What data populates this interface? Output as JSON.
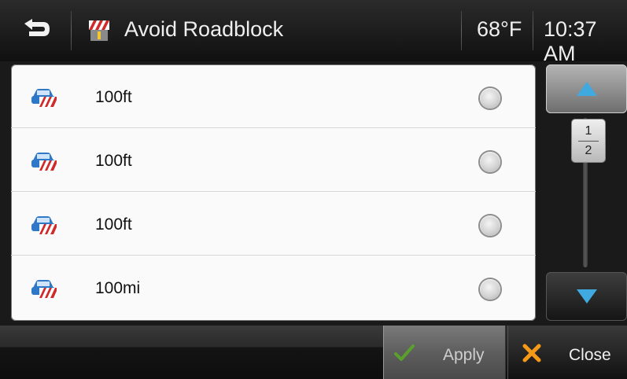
{
  "header": {
    "title": "Avoid Roadblock",
    "temperature": "68°F",
    "time": "10:37 AM",
    "back_icon": "back-arrow-icon",
    "title_icon": "roadblock-icon"
  },
  "list": {
    "items": [
      {
        "label": "100ft",
        "icon": "car-roadblock-icon",
        "selected": false
      },
      {
        "label": "100ft",
        "icon": "car-roadblock-icon",
        "selected": false
      },
      {
        "label": "100ft",
        "icon": "car-roadblock-icon",
        "selected": false
      },
      {
        "label": "100mi",
        "icon": "car-roadblock-icon",
        "selected": false
      }
    ]
  },
  "scroll": {
    "current_page": "1",
    "total_pages": "2",
    "up_icon": "triangle-up-icon",
    "down_icon": "triangle-down-icon"
  },
  "footer": {
    "apply_label": "Apply",
    "close_label": "Close",
    "apply_icon": "checkmark-icon",
    "close_icon": "x-icon"
  },
  "colors": {
    "accent_blue": "#3fa9e0",
    "check_green": "#5aa02c",
    "close_orange": "#f59a18",
    "roadblock_red": "#d02a2a"
  }
}
